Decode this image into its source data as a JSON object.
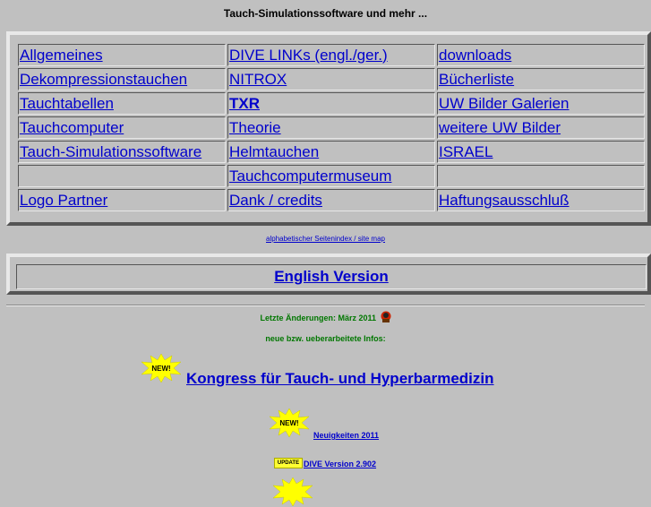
{
  "page": {
    "title": "Tauch-Simulationssoftware und mehr ..."
  },
  "nav": {
    "rows": [
      [
        "Allgemeines",
        "DIVE LINKs (engl./ger.)",
        "downloads"
      ],
      [
        "Dekompressionstauchen",
        "NITROX",
        "Bücherliste"
      ],
      [
        "Tauchtabellen",
        "TXR",
        "UW Bilder Galerien"
      ],
      [
        "Tauchcomputer",
        "Theorie",
        "weitere UW Bilder"
      ],
      [
        "Tauch-Simulationssoftware",
        "Helmtauchen",
        "ISRAEL"
      ],
      [
        "",
        "Tauchcomputermuseum",
        ""
      ],
      [
        "Logo Partner",
        "Dank / credits",
        "Haftungsausschluß"
      ]
    ]
  },
  "sitemap": "alphabetischer Seitenindex / site map",
  "english": "English Version",
  "updates": {
    "last_changes": "Letzte Änderungen: März 2011",
    "new_info": "neue bzw. ueberarbeitete Infos:",
    "new_badge": "NEW!",
    "update_badge": "UPDATE",
    "kongress": "Kongress für Tauch- und Hyperbarmedizin",
    "news": "Neuigkeiten 2011",
    "dive_version": "DIVE Version 2.902"
  },
  "colors": {
    "background": "#c0c0c0",
    "link": "#0000cc",
    "green": "#007700",
    "badge": "#ffff00"
  }
}
